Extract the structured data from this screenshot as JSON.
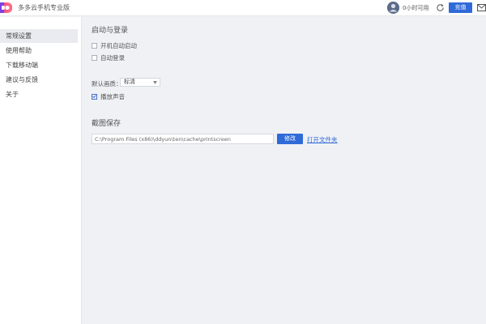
{
  "app": {
    "title": "多多云手机专业版",
    "logo_icon": "dd-logo-icon"
  },
  "header": {
    "time_text": "0小时可用",
    "refresh_icon": "refresh-icon",
    "recharge_label": "充值",
    "mail_icon": "mail-icon",
    "accent_color": "#2f6ad8"
  },
  "sidebar": {
    "items": [
      {
        "label": "常规设置",
        "active": true
      },
      {
        "label": "使用帮助",
        "active": false
      },
      {
        "label": "下载移动端",
        "active": false
      },
      {
        "label": "建议与反馈",
        "active": false
      },
      {
        "label": "关于",
        "active": false
      }
    ]
  },
  "settings": {
    "startup": {
      "title": "启动与登录",
      "autostart_label": "开机自动启动",
      "autostart_checked": false,
      "autologin_label": "自动登录",
      "autologin_checked": false
    },
    "quality": {
      "label": "默认画质：",
      "selected": "标清"
    },
    "sound": {
      "label": "播放声音",
      "checked": true
    },
    "screenshot": {
      "title": "截图保存",
      "path": "C:\\Program Files (x86)\\ddyun\\ten\\cache\\printscreen",
      "modify_label": "修改",
      "open_folder_label": "打开文件夹"
    }
  }
}
